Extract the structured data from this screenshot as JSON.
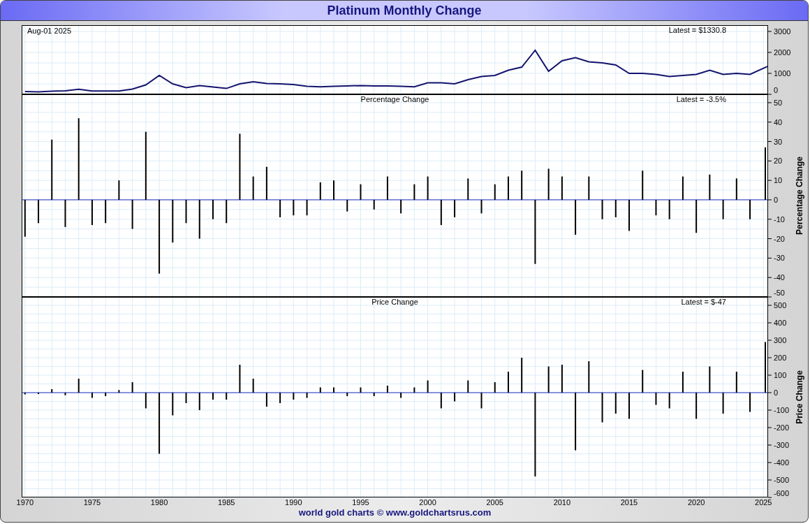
{
  "title": "Platinum Monthly Change",
  "panels": [
    {
      "date_label": "Aug-01  2025",
      "latest": "Latest = $1330.8",
      "chart_data": {
        "type": "line",
        "xlim": [
          1969.75,
          2025.35
        ],
        "grid": true,
        "ylim": [
          0,
          3300
        ],
        "yticks": [
          0,
          1000,
          2000,
          3000
        ],
        "x": [
          1970,
          1971,
          1972,
          1973,
          1974,
          1975,
          1976,
          1977,
          1978,
          1979,
          1980,
          1981,
          1982,
          1983,
          1984,
          1985,
          1986,
          1987,
          1988,
          1989,
          1990,
          1991,
          1992,
          1993,
          1994,
          1995,
          1996,
          1997,
          1998,
          1999,
          2000,
          2001,
          2002,
          2003,
          2004,
          2005,
          2006,
          2007,
          2008,
          2009,
          2010,
          2011,
          2012,
          2013,
          2014,
          2015,
          2016,
          2017,
          2018,
          2019,
          2020,
          2021,
          2022,
          2023,
          2024,
          2025.3
        ],
        "series": [
          {
            "color": "#14146e",
            "values": [
              130,
              120,
              150,
              170,
              240,
              160,
              160,
              160,
              250,
              450,
              900,
              500,
              320,
              420,
              350,
              280,
              500,
              600,
              520,
              500,
              470,
              380,
              360,
              380,
              400,
              420,
              400,
              400,
              380,
              360,
              550,
              550,
              500,
              700,
              850,
              900,
              1150,
              1300,
              2100,
              1100,
              1600,
              1750,
              1550,
              1500,
              1400,
              1000,
              1000,
              950,
              850,
              900,
              950,
              1150,
              950,
              1000,
              950,
              1330
            ]
          }
        ]
      }
    },
    {
      "latest": "Latest = -3.5%",
      "chart_data": {
        "type": "bar",
        "title": "Percentage Change",
        "ylabel": "Percentage Change",
        "xlim": [
          1969.75,
          2025.35
        ],
        "grid": true,
        "ref_lines": [
          {
            "axis": "y",
            "value": 0,
            "color": "#2030c0"
          }
        ],
        "ylim": [
          -50,
          54.3
        ],
        "yticks": [
          -50,
          -40,
          -30,
          -20,
          -10,
          0,
          10,
          20,
          30,
          40,
          50
        ],
        "x": [
          1970,
          1971,
          1972,
          1973,
          1974,
          1975,
          1976,
          1977,
          1978,
          1979,
          1980,
          1981,
          1982,
          1983,
          1984,
          1985,
          1986,
          1987,
          1988,
          1989,
          1990,
          1991,
          1992,
          1993,
          1994,
          1995,
          1996,
          1997,
          1998,
          1999,
          2000,
          2001,
          2002,
          2003,
          2004,
          2005,
          2006,
          2007,
          2008,
          2009,
          2010,
          2011,
          2012,
          2013,
          2014,
          2015,
          2016,
          2017,
          2018,
          2019,
          2020,
          2021,
          2022,
          2023,
          2024,
          2025.3
        ],
        "values": [
          -19,
          -12,
          31,
          -14,
          42,
          -13,
          -12,
          10,
          -15,
          35,
          -38,
          -22,
          -12,
          -20,
          -10,
          -12,
          34,
          12,
          17,
          -9,
          -8,
          -8,
          9,
          10,
          -6,
          8,
          -5,
          12,
          -7,
          8,
          12,
          -13,
          -9,
          11,
          -7,
          8,
          12,
          15,
          -33,
          16,
          12,
          -18,
          12,
          -10,
          -9,
          -16,
          15,
          -8,
          -10,
          12,
          -17,
          13,
          -10,
          11,
          -10,
          27
        ]
      }
    },
    {
      "latest": "Latest = $-47",
      "chart_data": {
        "type": "bar",
        "title": "Price Change",
        "ylabel": "Price Change",
        "xlim": [
          1969.75,
          2025.35
        ],
        "grid": true,
        "ref_lines": [
          {
            "axis": "y",
            "value": 0,
            "color": "#2030c0"
          }
        ],
        "ylim": [
          -600,
          548
        ],
        "yticks": [
          -600,
          -500,
          -400,
          -300,
          -200,
          -100,
          0,
          100,
          200,
          300,
          400,
          500
        ],
        "xticks": [
          1970,
          1975,
          1980,
          1985,
          1990,
          1995,
          2000,
          2005,
          2010,
          2015,
          2020,
          2025
        ],
        "x": [
          1970,
          1971,
          1972,
          1973,
          1974,
          1975,
          1976,
          1977,
          1978,
          1979,
          1980,
          1981,
          1982,
          1983,
          1984,
          1985,
          1986,
          1987,
          1988,
          1989,
          1990,
          1991,
          1992,
          1993,
          1994,
          1995,
          1996,
          1997,
          1998,
          1999,
          2000,
          2001,
          2002,
          2003,
          2004,
          2005,
          2006,
          2007,
          2008,
          2009,
          2010,
          2011,
          2012,
          2013,
          2014,
          2015,
          2016,
          2017,
          2018,
          2019,
          2020,
          2021,
          2022,
          2023,
          2024,
          2025.3
        ],
        "values": [
          -10,
          -8,
          20,
          -15,
          80,
          -30,
          -20,
          15,
          60,
          -90,
          -350,
          -130,
          -60,
          -100,
          -40,
          -40,
          160,
          80,
          -80,
          -60,
          -40,
          -30,
          30,
          30,
          -20,
          30,
          -20,
          40,
          -30,
          30,
          70,
          -90,
          -50,
          70,
          -90,
          60,
          120,
          200,
          -480,
          150,
          160,
          -330,
          180,
          -170,
          -120,
          -150,
          130,
          -70,
          -90,
          120,
          -150,
          150,
          -120,
          120,
          -110,
          290
        ]
      }
    }
  ],
  "footer": "world gold charts © www.goldchartsrus.com"
}
